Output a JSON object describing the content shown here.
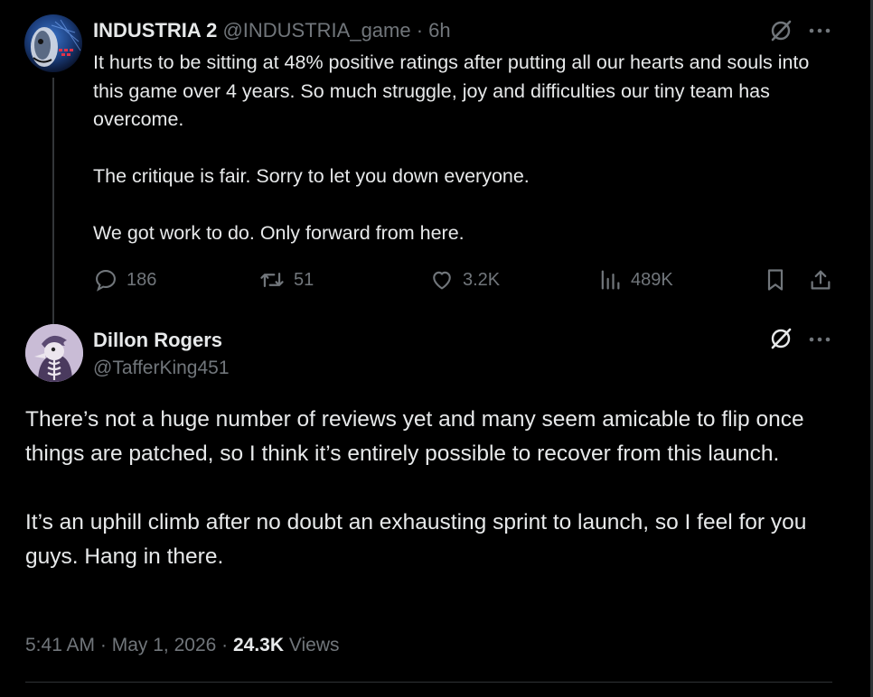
{
  "tweet": {
    "display_name": "INDUSTRIA 2",
    "handle": "@INDUSTRIA_game",
    "separator": " · ",
    "age": "6h",
    "paragraphs": [
      "It hurts to be sitting at 48% positive ratings after putting all our hearts and souls into this game over 4 years. So much struggle, joy and difficulties our tiny team has overcome.",
      "The critique is fair. Sorry to let you down everyone.",
      "We got work to do. Only forward from here."
    ],
    "replies": "186",
    "reposts": "51",
    "likes": "3.2K",
    "views": "489K"
  },
  "reply": {
    "display_name": "Dillon Rogers",
    "handle": "@TafferKing451",
    "paragraphs": [
      "There’s not a huge number of reviews yet and many seem amicable to flip once things are patched, so I think it’s entirely possible to recover from this launch.",
      "It’s an uphill climb after no doubt an exhausting sprint to launch, so I feel for you guys. Hang in there."
    ],
    "time": "5:41 AM",
    "dot": " · ",
    "date": "May 1, 2026",
    "views_count": "24.3K",
    "views_label": " Views"
  },
  "icons": {
    "grok": "grok-icon",
    "more": "more-icon",
    "reply": "reply-icon",
    "repost": "repost-icon",
    "like": "heart-icon",
    "views": "analytics-icon",
    "bookmark": "bookmark-icon",
    "share": "share-icon"
  },
  "colors": {
    "background": "#000000",
    "text": "#e7e9ea",
    "muted": "#71767b",
    "line": "#2f3336"
  }
}
